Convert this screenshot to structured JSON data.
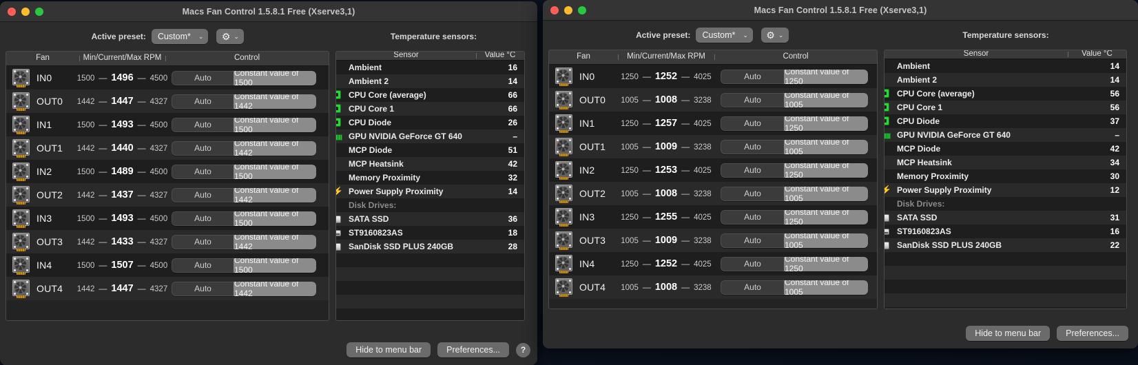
{
  "app": {
    "title": "Macs Fan Control 1.5.8.1 Free (Xserve3,1)"
  },
  "toolbar": {
    "preset_label": "Active preset:",
    "preset_value": "Custom*",
    "chevron": "⌄",
    "gear_glyph": "⚙",
    "temp_header": "Temperature sensors:"
  },
  "fan_table": {
    "headers": {
      "fan": "Fan",
      "rpm": "Min/Current/Max RPM",
      "control": "Control"
    },
    "auto_label": "Auto"
  },
  "sensor_table": {
    "headers": {
      "sensor": "Sensor",
      "value": "Value °C"
    }
  },
  "footer": {
    "hide_label": "Hide to menu bar",
    "prefs_label": "Preferences...",
    "help_label": "?"
  },
  "left_window": {
    "fans": [
      {
        "name": "IN0",
        "min": "1500",
        "current": "1496",
        "max": "4500",
        "constant": "Constant value of 1500"
      },
      {
        "name": "OUT0",
        "min": "1442",
        "current": "1447",
        "max": "4327",
        "constant": "Constant value of 1442"
      },
      {
        "name": "IN1",
        "min": "1500",
        "current": "1493",
        "max": "4500",
        "constant": "Constant value of 1500"
      },
      {
        "name": "OUT1",
        "min": "1442",
        "current": "1440",
        "max": "4327",
        "constant": "Constant value of 1442"
      },
      {
        "name": "IN2",
        "min": "1500",
        "current": "1489",
        "max": "4500",
        "constant": "Constant value of 1500"
      },
      {
        "name": "OUT2",
        "min": "1442",
        "current": "1437",
        "max": "4327",
        "constant": "Constant value of 1442"
      },
      {
        "name": "IN3",
        "min": "1500",
        "current": "1493",
        "max": "4500",
        "constant": "Constant value of 1500"
      },
      {
        "name": "OUT3",
        "min": "1442",
        "current": "1433",
        "max": "4327",
        "constant": "Constant value of 1442"
      },
      {
        "name": "IN4",
        "min": "1500",
        "current": "1507",
        "max": "4500",
        "constant": "Constant value of 1500"
      },
      {
        "name": "OUT4",
        "min": "1442",
        "current": "1447",
        "max": "4327",
        "constant": "Constant value of 1442"
      }
    ],
    "sensors": [
      {
        "name": "Ambient",
        "value": "16",
        "icon": "none"
      },
      {
        "name": "Ambient 2",
        "value": "14",
        "icon": "none"
      },
      {
        "name": "CPU Core (average)",
        "value": "66",
        "icon": "cpu-chip-icon"
      },
      {
        "name": "CPU Core 1",
        "value": "66",
        "icon": "cpu-chip-icon"
      },
      {
        "name": "CPU Diode",
        "value": "26",
        "icon": "cpu-chip-icon"
      },
      {
        "name": "GPU NVIDIA GeForce GT 640",
        "value": "–",
        "icon": "gpu-card-icon"
      },
      {
        "name": "MCP Diode",
        "value": "51",
        "icon": "none"
      },
      {
        "name": "MCP Heatsink",
        "value": "42",
        "icon": "none"
      },
      {
        "name": "Memory Proximity",
        "value": "32",
        "icon": "none"
      },
      {
        "name": "Power Supply Proximity",
        "value": "14",
        "icon": "bolt-icon"
      },
      {
        "name": "Disk Drives:",
        "value": "",
        "icon": "none",
        "group": true
      },
      {
        "name": "SATA SSD",
        "value": "36",
        "icon": "ssd-icon"
      },
      {
        "name": "ST9160823AS",
        "value": "18",
        "icon": "hdd-icon"
      },
      {
        "name": "SanDisk SSD PLUS 240GB",
        "value": "28",
        "icon": "ssd-icon"
      }
    ]
  },
  "right_window": {
    "fans": [
      {
        "name": "IN0",
        "min": "1250",
        "current": "1252",
        "max": "4025",
        "constant": "Constant value of 1250"
      },
      {
        "name": "OUT0",
        "min": "1005",
        "current": "1008",
        "max": "3238",
        "constant": "Constant value of 1005"
      },
      {
        "name": "IN1",
        "min": "1250",
        "current": "1257",
        "max": "4025",
        "constant": "Constant value of 1250"
      },
      {
        "name": "OUT1",
        "min": "1005",
        "current": "1009",
        "max": "3238",
        "constant": "Constant value of 1005"
      },
      {
        "name": "IN2",
        "min": "1250",
        "current": "1253",
        "max": "4025",
        "constant": "Constant value of 1250"
      },
      {
        "name": "OUT2",
        "min": "1005",
        "current": "1008",
        "max": "3238",
        "constant": "Constant value of 1005"
      },
      {
        "name": "IN3",
        "min": "1250",
        "current": "1255",
        "max": "4025",
        "constant": "Constant value of 1250"
      },
      {
        "name": "OUT3",
        "min": "1005",
        "current": "1009",
        "max": "3238",
        "constant": "Constant value of 1005"
      },
      {
        "name": "IN4",
        "min": "1250",
        "current": "1252",
        "max": "4025",
        "constant": "Constant value of 1250"
      },
      {
        "name": "OUT4",
        "min": "1005",
        "current": "1008",
        "max": "3238",
        "constant": "Constant value of 1005"
      }
    ],
    "sensors": [
      {
        "name": "Ambient",
        "value": "14",
        "icon": "none"
      },
      {
        "name": "Ambient 2",
        "value": "14",
        "icon": "none"
      },
      {
        "name": "CPU Core (average)",
        "value": "56",
        "icon": "cpu-chip-icon"
      },
      {
        "name": "CPU Core 1",
        "value": "56",
        "icon": "cpu-chip-icon"
      },
      {
        "name": "CPU Diode",
        "value": "37",
        "icon": "cpu-chip-icon"
      },
      {
        "name": "GPU NVIDIA GeForce GT 640",
        "value": "–",
        "icon": "gpu-card-icon"
      },
      {
        "name": "MCP Diode",
        "value": "42",
        "icon": "none"
      },
      {
        "name": "MCP Heatsink",
        "value": "34",
        "icon": "none"
      },
      {
        "name": "Memory Proximity",
        "value": "30",
        "icon": "none"
      },
      {
        "name": "Power Supply Proximity",
        "value": "12",
        "icon": "bolt-icon"
      },
      {
        "name": "Disk Drives:",
        "value": "",
        "icon": "none",
        "group": true
      },
      {
        "name": "SATA SSD",
        "value": "31",
        "icon": "ssd-icon"
      },
      {
        "name": "ST9160823AS",
        "value": "16",
        "icon": "hdd-icon"
      },
      {
        "name": "SanDisk SSD PLUS 240GB",
        "value": "22",
        "icon": "ssd-icon"
      }
    ]
  }
}
